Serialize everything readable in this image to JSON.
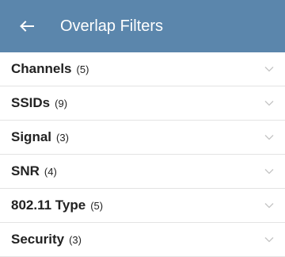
{
  "header": {
    "title": "Overlap Filters"
  },
  "filters": [
    {
      "label": "Channels",
      "count": "(5)"
    },
    {
      "label": "SSIDs",
      "count": "(9)"
    },
    {
      "label": "Signal",
      "count": "(3)"
    },
    {
      "label": "SNR",
      "count": "(4)"
    },
    {
      "label": "802.11 Type",
      "count": "(5)"
    },
    {
      "label": "Security",
      "count": "(3)"
    }
  ],
  "colors": {
    "header_bg": "#5b86ac",
    "header_text": "#ffffff",
    "divider": "#e3e3e3",
    "chevron": "#c4c4c4"
  },
  "icons": {
    "back": "arrow-left-icon",
    "expand": "chevron-down-icon"
  }
}
